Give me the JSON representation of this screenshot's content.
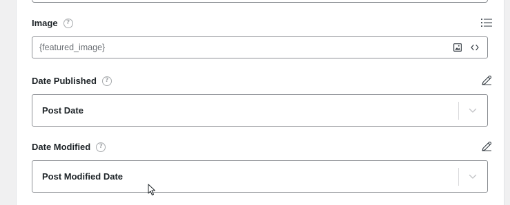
{
  "image_field": {
    "label": "Image",
    "value": "{featured_image}",
    "icons": {
      "help": "help-icon",
      "menu": "list-icon",
      "media": "image-icon",
      "code": "code-icon"
    }
  },
  "date_published": {
    "label": "Date Published",
    "selected": "Post Date",
    "icons": {
      "help": "help-icon",
      "edit": "pencil-icon",
      "dropdown": "chevron-down-icon"
    }
  },
  "date_modified": {
    "label": "Date Modified",
    "selected": "Post Modified Date",
    "icons": {
      "help": "help-icon",
      "edit": "pencil-icon",
      "dropdown": "chevron-down-icon"
    }
  },
  "colors": {
    "border": "#8c8f94",
    "text": "#1d2327",
    "muted": "#a7aaad",
    "background": "#f0f0f1"
  }
}
